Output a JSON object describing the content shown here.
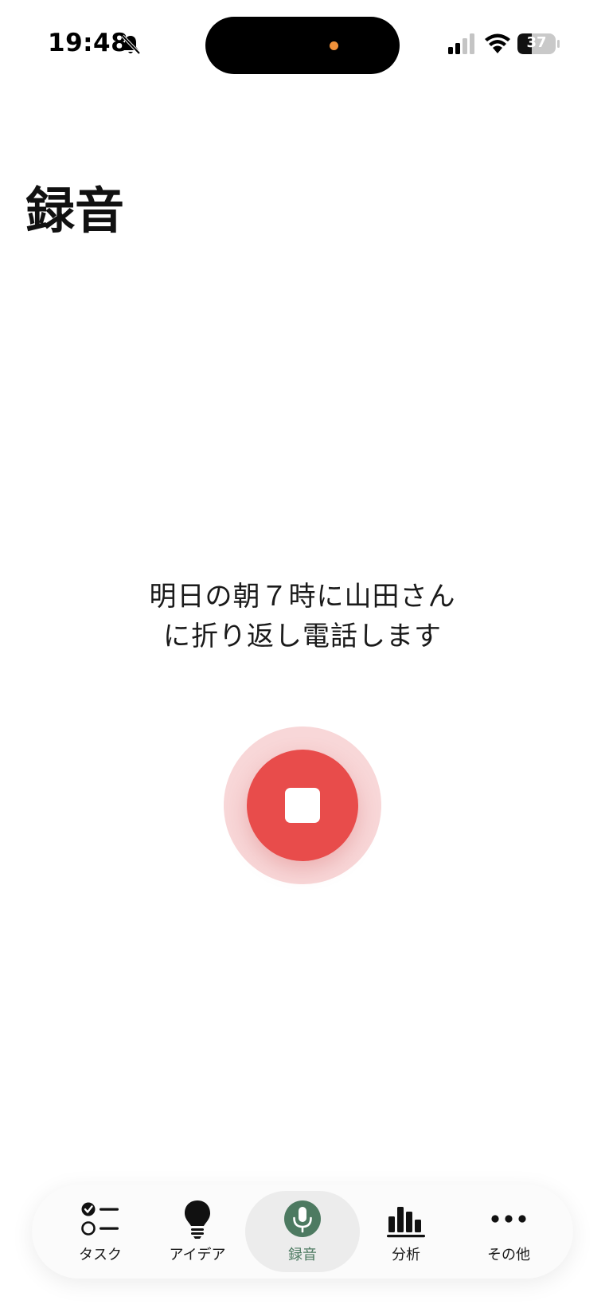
{
  "status_bar": {
    "time": "19:48",
    "battery": "37",
    "icons": [
      "bell-off-icon",
      "signal-icon",
      "wifi-icon",
      "battery-icon"
    ]
  },
  "page": {
    "title": "録音"
  },
  "transcript": {
    "line1": "明日の朝７時に山田さん",
    "line2": "に折り返し電話します"
  },
  "recorder": {
    "state": "recording",
    "button_icon": "stop-icon",
    "colors": {
      "button": "#e84c4b",
      "halo": "#f8d7d8"
    }
  },
  "tab_bar": {
    "active_index": 2,
    "active_color": "#4d7a61",
    "tabs": [
      {
        "label": "タスク",
        "icon": "checklist-icon"
      },
      {
        "label": "アイデア",
        "icon": "lightbulb-icon"
      },
      {
        "label": "録音",
        "icon": "microphone-icon"
      },
      {
        "label": "分析",
        "icon": "bar-chart-icon"
      },
      {
        "label": "その他",
        "icon": "more-dots-icon"
      }
    ]
  }
}
